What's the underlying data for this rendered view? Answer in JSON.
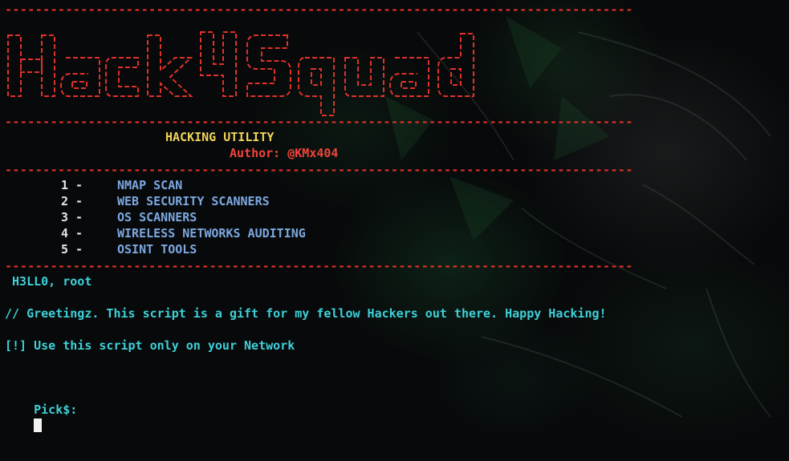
{
  "banner": {
    "logo_text": "Hack4Squad",
    "separator": "-----------------------------------------------------------------------------------",
    "logo_color": "#e0312b"
  },
  "header": {
    "title": "HACKING UTILITY",
    "author": "Author: @KMx404"
  },
  "menu": {
    "items": [
      {
        "number": "1 -",
        "label": "NMAP SCAN"
      },
      {
        "number": "2 -",
        "label": "WEB SECURITY SCANNERS"
      },
      {
        "number": "3 -",
        "label": "OS SCANNERS"
      },
      {
        "number": "4 -",
        "label": "WIRELESS NETWORKS AUDITING"
      },
      {
        "number": "5 -",
        "label": "OSINT TOOLS"
      }
    ]
  },
  "greeting": {
    "hello": " H3LL0, root",
    "message": "// Greetingz. This script is a gift for my fellow Hackers out there. Happy Hacking!",
    "warning": "[!] Use this script only on your Network"
  },
  "prompt": {
    "label": "Pick$:"
  },
  "colors": {
    "separator": "#e0312b",
    "title": "#f0d35a",
    "author": "#f0453a",
    "menu_number": "#e6e6e6",
    "menu_label": "#7da8e0",
    "text": "#3fd0d8",
    "background": "#07090a"
  }
}
